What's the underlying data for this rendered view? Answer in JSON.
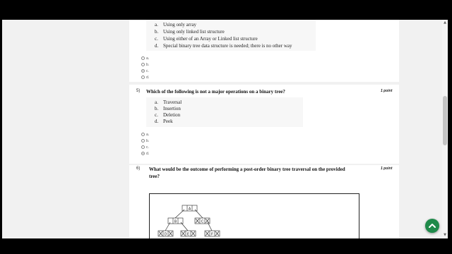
{
  "q4": {
    "options": [
      {
        "letter": "a.",
        "text": "Using only array"
      },
      {
        "letter": "b.",
        "text": "Using only linked list structure"
      },
      {
        "letter": "c.",
        "text": "Using either of an Array or Linked list structure"
      },
      {
        "letter": "d.",
        "text": "Special binary tree data structure is needed; there is  no other way"
      }
    ],
    "radios": [
      "a.",
      "b.",
      "c.",
      "d."
    ],
    "selected": "c."
  },
  "q5": {
    "number": "5)",
    "text": "Which of the following is not a major operations on a binary tree?",
    "points": "1 point",
    "options": [
      {
        "letter": "a.",
        "text": "Traversal"
      },
      {
        "letter": "b.",
        "text": "Insertion"
      },
      {
        "letter": "c.",
        "text": "Deletion"
      },
      {
        "letter": "d.",
        "text": "Peek"
      }
    ],
    "radios": [
      "a.",
      "b.",
      "c.",
      "d."
    ],
    "selected": "d."
  },
  "q6": {
    "number": "6)",
    "text": "What would be the outcome of performing a post-order binary tree traversal on the provided tree?",
    "points": "1 point",
    "tree_nodes": [
      "A",
      "B",
      "C",
      "D",
      "E",
      "F"
    ]
  },
  "icons": {
    "scroll_up": "scroll-up-arrow",
    "scroll_down": "scroll-down-arrow",
    "fab": "chevron-up-icon"
  },
  "colors": {
    "fab": "#1f8a4a",
    "card": "#ffffff",
    "page_bg": "#f1f1f1"
  }
}
